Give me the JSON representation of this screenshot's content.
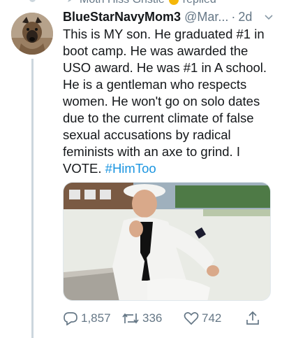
{
  "context": {
    "text": "Moth Hiss Gristle",
    "suffix": "replied"
  },
  "tweet": {
    "display_name": "BlueStarNavyMom3",
    "handle": "@Mar...",
    "separator": "·",
    "time": "2d",
    "body": "This is MY son. He graduated #1 in boot camp. He was awarded the USO award. He was #1 in A school. He is a gentleman who respects women. He won't go on solo dates due to the current climate of false sexual accusations by radical feminists with an axe to grind. I VOTE.",
    "hashtag": "#HimToo"
  },
  "actions": {
    "replies": "1,857",
    "retweets": "336",
    "likes": "742"
  },
  "icons": {
    "reply": "reply-icon",
    "retweet": "retweet-icon",
    "like": "heart-icon",
    "share": "share-icon",
    "more": "chevron-down-icon"
  },
  "colors": {
    "link": "#1b95e0",
    "muted": "#657786",
    "text": "#14171a",
    "thread_line": "#ccd6dd"
  }
}
